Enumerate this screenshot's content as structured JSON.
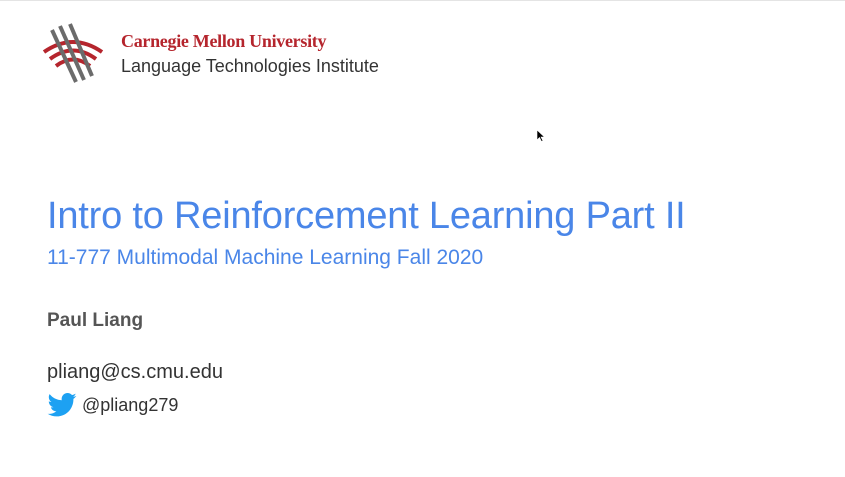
{
  "colors": {
    "cmu_red": "#b5252d",
    "logo_gray": "#6b6b6b",
    "title_blue": "#4a86e8",
    "text_dark": "#333333",
    "text_author": "#555555",
    "twitter_blue": "#1da1f2"
  },
  "header": {
    "university": "Carnegie Mellon University",
    "institute": "Language Technologies Institute",
    "logo_icon": "cmu-tartan-wave-icon"
  },
  "slide": {
    "title": "Intro to Reinforcement Learning Part II",
    "subtitle": "11-777 Multimodal Machine Learning Fall 2020",
    "author": "Paul Liang",
    "email": "pliang@cs.cmu.edu",
    "twitter_handle": "@pliang279",
    "twitter_icon": "twitter-bird-icon"
  },
  "cursor_icon": "mouse-pointer-icon"
}
